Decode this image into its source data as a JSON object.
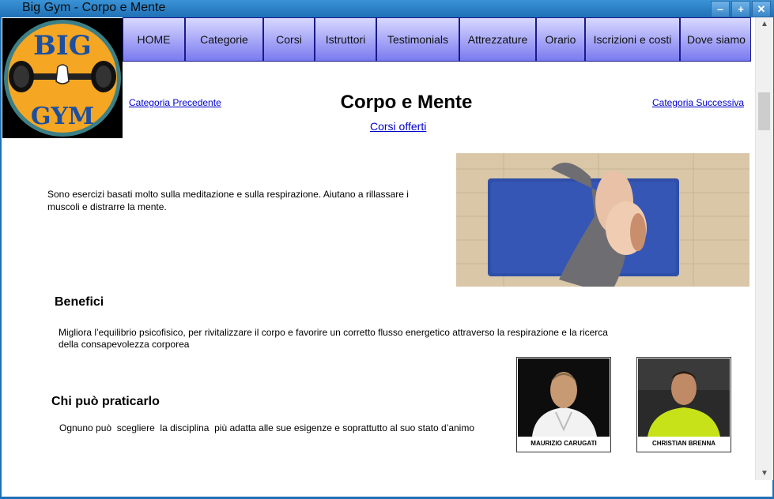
{
  "window": {
    "title": "Big Gym - Corpo e Mente",
    "buttons": {
      "minimize": "‒",
      "maximize": "+",
      "close": "✕"
    }
  },
  "logo": {
    "top_text": "BIG",
    "bottom_text": "GYM"
  },
  "nav": {
    "items": [
      {
        "label": "HOME"
      },
      {
        "label": "Categorie"
      },
      {
        "label": "Corsi"
      },
      {
        "label": "Istruttori"
      },
      {
        "label": "Testimonials"
      },
      {
        "label": "Attrezzature"
      },
      {
        "label": "Orario"
      },
      {
        "label": "Iscrizioni e costi"
      },
      {
        "label": "Dove siamo"
      }
    ]
  },
  "header": {
    "prev_link": "Categoria Precedente",
    "next_link": "Categoria Successiva",
    "title": "Corpo e Mente",
    "courses_link": "Corsi offerti"
  },
  "intro": {
    "text": "Sono esercizi basati molto sulla meditazione e sulla respirazione. Aiutano a rillassare i muscoli e distrarre la mente."
  },
  "benefits": {
    "heading": "Benefici",
    "text": "Migliora l’equilibrio psicofisico, per rivitalizzare il corpo e favorire un corretto flusso energetico attraverso la respirazione e la ricerca della consapevolezza corporea"
  },
  "who": {
    "heading": "Chi può praticarlo",
    "text": "Ognuno può  scegliere  la disciplina  più adatta alle sue esigenze e soprattutto al suo stato d’animo"
  },
  "trainers": [
    {
      "name": "MAURIZIO CARUGATI"
    },
    {
      "name": "CHRISTIAN BRENNA"
    }
  ],
  "colors": {
    "titlebar": "#1f70b6",
    "nav_gradient_top": "#d8d8ff",
    "nav_gradient_bottom": "#7a7af0",
    "logo_orange": "#f5a623",
    "link": "#0000cc"
  }
}
